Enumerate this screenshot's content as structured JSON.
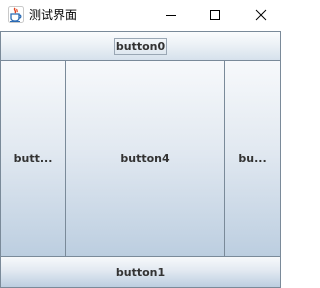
{
  "window": {
    "title": "测试界面",
    "controls": {
      "minimize_icon": "minimize-icon",
      "maximize_icon": "maximize-icon",
      "close_icon": "close-icon"
    }
  },
  "buttons": {
    "north": "button0",
    "west": "butt...",
    "center": "button4",
    "east": "bu...",
    "south": "button1"
  },
  "colors": {
    "button_border": "#7a8a99",
    "button_gradient_top": "#f7f9fb",
    "button_gradient_bottom": "#bccee0",
    "label": "#333333"
  }
}
